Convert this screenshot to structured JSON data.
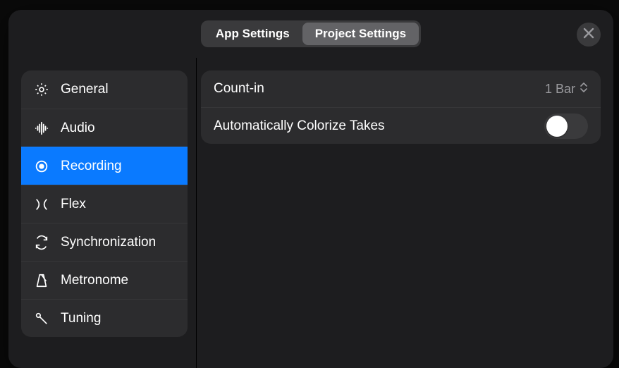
{
  "header": {
    "tabs": {
      "app": "App Settings",
      "project": "Project Settings"
    },
    "active_tab": "project"
  },
  "sidebar": {
    "items": [
      {
        "id": "general",
        "label": "General",
        "icon": "gear-icon"
      },
      {
        "id": "audio",
        "label": "Audio",
        "icon": "waveform-icon"
      },
      {
        "id": "recording",
        "label": "Recording",
        "icon": "record-icon"
      },
      {
        "id": "flex",
        "label": "Flex",
        "icon": "flex-icon"
      },
      {
        "id": "sync",
        "label": "Synchronization",
        "icon": "sync-icon"
      },
      {
        "id": "metronome",
        "label": "Metronome",
        "icon": "metronome-icon"
      },
      {
        "id": "tuning",
        "label": "Tuning",
        "icon": "tuning-icon"
      }
    ],
    "selected": "recording"
  },
  "settings": {
    "count_in": {
      "label": "Count-in",
      "value": "1 Bar"
    },
    "colorize": {
      "label": "Automatically Colorize Takes",
      "value": false
    }
  }
}
